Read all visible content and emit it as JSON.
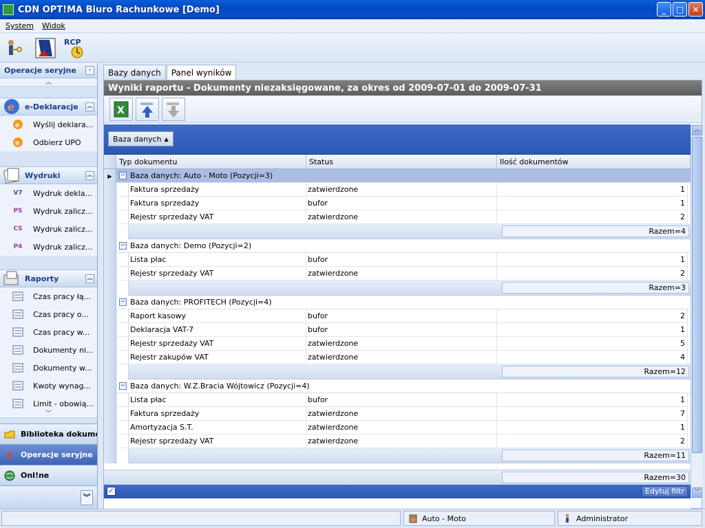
{
  "window": {
    "title": "CDN OPT!MA Biuro Rachunkowe [Demo]",
    "min": "_",
    "max": "□",
    "close": "✕"
  },
  "menu": {
    "system": "System",
    "widok": "Widok"
  },
  "toolbar": {
    "rcp_label": "RCP"
  },
  "leftpanel": {
    "header": "Operacje seryjne",
    "sections": {
      "edeklaracje": {
        "title": "e-Deklaracje",
        "items": [
          "Wyślij deklara...",
          "Odbierz UPO"
        ]
      },
      "wydruki": {
        "title": "Wydruki",
        "items": [
          "Wydruk dekla...",
          "Wydruk zalicz...",
          "Wydruk zalicz...",
          "Wydruk zalicz..."
        ],
        "badges": [
          "V7",
          "PS",
          "CS",
          "P4"
        ]
      },
      "raporty": {
        "title": "Raporty",
        "items": [
          "Czas pracy łą...",
          "Czas pracy o...",
          "Czas pracy w...",
          "Dokumenty ni...",
          "Dokumenty w...",
          "Kwoty wynag...",
          "Limit - obowią..."
        ]
      }
    },
    "nav": {
      "biblioteka": "Biblioteka dokumentów",
      "operacje": "Operacje seryjne",
      "online": "Onl!ne"
    }
  },
  "tabs": [
    "Bazy danych",
    "Panel wyników"
  ],
  "report": {
    "title": "Wyniki raportu - Dokumenty niezaksięgowane, za okres od 2009-07-01 do 2009-07-31",
    "group_by": "Baza danych",
    "columns": [
      "Typ dokumentu",
      "Status",
      "Ilość dokumentów"
    ],
    "groups": [
      {
        "header": "Baza danych: Auto - Moto (Pozycji=3)",
        "rows": [
          [
            "Faktura sprzedaży",
            "zatwierdzone",
            "1"
          ],
          [
            "Faktura sprzedaży",
            "bufor",
            "1"
          ],
          [
            "Rejestr sprzedaży VAT",
            "zatwierdzone",
            "2"
          ]
        ],
        "total": "Razem=4"
      },
      {
        "header": "Baza danych: Demo (Pozycji=2)",
        "rows": [
          [
            "Lista płac",
            "bufor",
            "1"
          ],
          [
            "Rejestr sprzedaży VAT",
            "zatwierdzone",
            "2"
          ]
        ],
        "total": "Razem=3"
      },
      {
        "header": "Baza danych: PROFITECH (Pozycji=4)",
        "rows": [
          [
            "Raport kasowy",
            "bufor",
            "2"
          ],
          [
            "Deklaracja VAT-7",
            "bufor",
            "1"
          ],
          [
            "Rejestr sprzedaży VAT",
            "zatwierdzone",
            "5"
          ],
          [
            "Rejestr zakupów VAT",
            "zatwierdzone",
            "4"
          ]
        ],
        "total": "Razem=12"
      },
      {
        "header": "Baza danych: W.Z.Bracia Wójtowicz (Pozycji=4)",
        "rows": [
          [
            "Lista płac",
            "bufor",
            "1"
          ],
          [
            "Faktura sprzedaży",
            "zatwierdzone",
            "7"
          ],
          [
            "Amortyzacja S.T.",
            "zatwierdzone",
            "1"
          ],
          [
            "Rejestr sprzedaży VAT",
            "zatwierdzone",
            "2"
          ]
        ],
        "total": "Razem=11"
      }
    ],
    "grand_total": "Razem=30",
    "edit_filter": "Edytuj filtr"
  },
  "status": {
    "company": "Auto - Moto",
    "user": "Administrator"
  }
}
